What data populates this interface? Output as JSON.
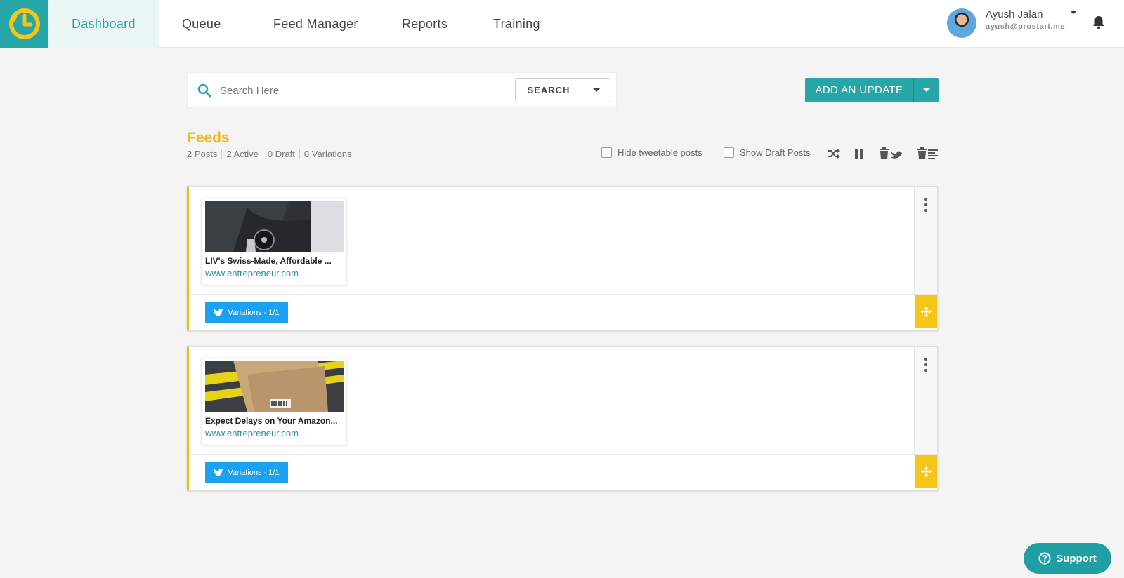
{
  "nav": {
    "items": [
      {
        "label": "Dashboard",
        "active": true
      },
      {
        "label": "Queue",
        "active": false
      },
      {
        "label": "Feed Manager",
        "active": false
      },
      {
        "label": "Reports",
        "active": false
      },
      {
        "label": "Training",
        "active": false
      }
    ]
  },
  "user": {
    "name": "Ayush Jalan",
    "email": "ayush@prostart.me"
  },
  "search": {
    "placeholder": "Search Here",
    "button_label": "SEARCH"
  },
  "add_update": {
    "label": "ADD AN UPDATE"
  },
  "feeds": {
    "title": "Feeds",
    "stats": [
      "2 Posts",
      "2 Active",
      "0 Draft",
      "0 Variations"
    ],
    "hide_tweetable_label": "Hide tweetable posts",
    "show_draft_label": "Show Draft Posts"
  },
  "posts": [
    {
      "title": "LIV's Swiss-Made, Affordable ...",
      "url": "www.entrepreneur.com",
      "variations_label": "Variations - 1/1"
    },
    {
      "title": "Expect Delays on Your Amazon...",
      "url": "www.entrepreneur.com",
      "variations_label": "Variations - 1/1"
    }
  ],
  "support": {
    "label": "Support"
  },
  "colors": {
    "accent": "#27a6a8",
    "feed_title": "#f5b914",
    "twitter": "#1da1f2",
    "move_handle": "#f5c518"
  }
}
